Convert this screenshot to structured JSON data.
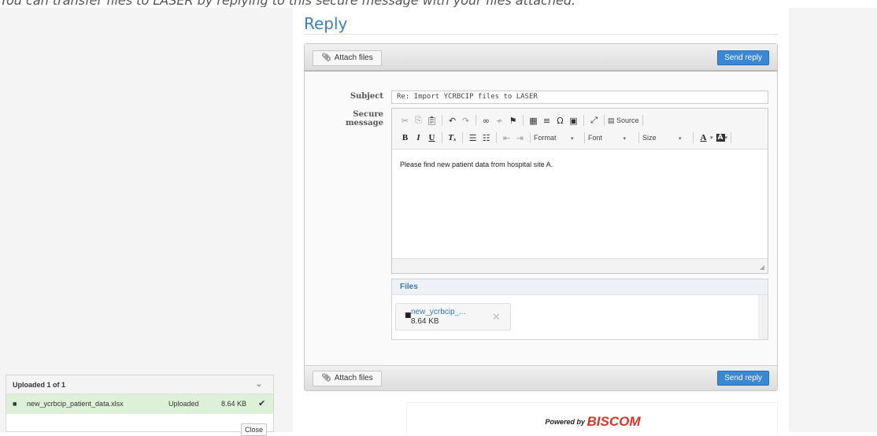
{
  "intro_text": "You can transfer files to LASER by replying to this secure message with your files attached.",
  "reply": {
    "title": "Reply",
    "attach_label": "Attach files",
    "send_label": "Send reply",
    "subject_label": "Subject",
    "subject_value": "Re: Import YCRBCIP files to LASER",
    "message_label": "Secure message",
    "message_body": "Please find new patient data from hospital site A."
  },
  "toolbar": {
    "source_label": "Source",
    "bold": "B",
    "italic": "I",
    "underline": "U",
    "format_label": "Format",
    "font_label": "Font",
    "size_label": "Size",
    "text_color_glyph": "A",
    "bg_color_glyph": "A"
  },
  "files": {
    "heading": "Files",
    "items": [
      {
        "name": "new_ycrbcip_...",
        "size": "8.64 KB"
      }
    ]
  },
  "footer": {
    "powered_by": "Powered by",
    "brand": "BISCOM",
    "brand_color": "#d0392b"
  },
  "uploads": {
    "header": "Uploaded 1 of 1",
    "rows": [
      {
        "filename": "new_ycrbcip_patient_data.xlsx",
        "status": "Uploaded",
        "size": "8.64 KB"
      }
    ],
    "close_label": "Close"
  },
  "colors": {
    "accent": "#3a87d4",
    "link": "#3a76b8",
    "success_row": "#dff0d8"
  }
}
